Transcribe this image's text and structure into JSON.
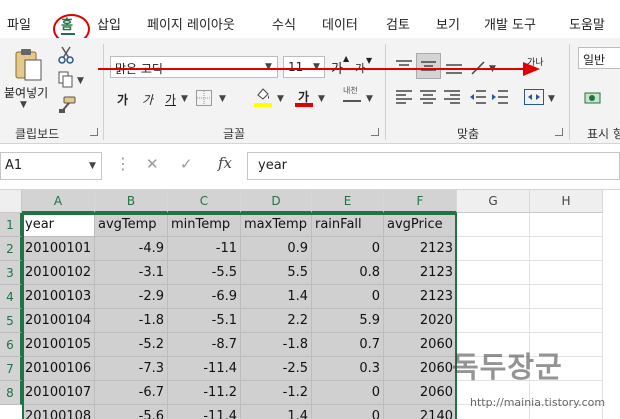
{
  "menu": {
    "tabs": [
      "파일",
      "홈",
      "삽입",
      "페이지 레이아웃",
      "수식",
      "데이터",
      "검토",
      "보기",
      "개발 도구",
      "도움말"
    ]
  },
  "ribbon": {
    "paste_label": "붙여넣기",
    "font_name": "맑은 고딕",
    "font_size": "11",
    "bold_label": "가",
    "italic_label": "가",
    "underline_label": "가",
    "font_color_label": "가",
    "grow_font_label": "가",
    "shrink_font_label": "가",
    "phonetic_label": "내천",
    "wrap_label": "가나",
    "number_format": "일반",
    "groups": {
      "clipboard": "클립보드",
      "font": "글꼴",
      "alignment": "맞춤",
      "number": "표시 형"
    },
    "colors": {
      "highlight": "#ffff00",
      "font_color": "#e00000"
    }
  },
  "formula_bar": {
    "name_box": "A1",
    "fx_label": "fx",
    "value": "year"
  },
  "sheet": {
    "columns": [
      "A",
      "B",
      "C",
      "D",
      "E",
      "F",
      "G",
      "H"
    ],
    "rows": [
      "1",
      "2",
      "3",
      "4",
      "5",
      "6",
      "7",
      "8"
    ],
    "cells": [
      [
        "year",
        "avgTemp",
        "minTemp",
        "maxTemp",
        "rainFall",
        "avgPrice"
      ],
      [
        "20100101",
        "-4.9",
        "-11",
        "0.9",
        "0",
        "2123"
      ],
      [
        "20100102",
        "-3.1",
        "-5.5",
        "5.5",
        "0.8",
        "2123"
      ],
      [
        "20100103",
        "-2.9",
        "-6.9",
        "1.4",
        "0",
        "2123"
      ],
      [
        "20100104",
        "-1.8",
        "-5.1",
        "2.2",
        "5.9",
        "2020"
      ],
      [
        "20100105",
        "-5.2",
        "-8.7",
        "-1.8",
        "0.7",
        "2060"
      ],
      [
        "20100106",
        "-7.3",
        "-11.4",
        "-2.5",
        "0.3",
        "2060"
      ],
      [
        "20100107",
        "-6.7",
        "-11.2",
        "-1.2",
        "0",
        "2060"
      ],
      [
        "20100108",
        "-5.6",
        "-11.4",
        "1.4",
        "0",
        "2140"
      ]
    ]
  },
  "watermark": {
    "text": "독두장군",
    "url": "http://mainia.tistory.com"
  }
}
